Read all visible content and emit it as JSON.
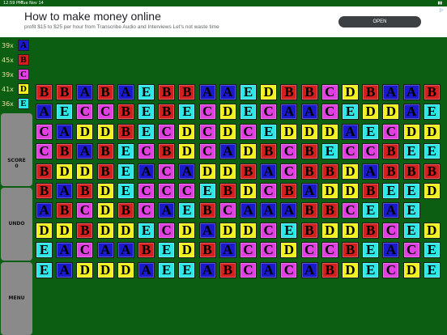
{
  "status": {
    "time": "12:59 PM",
    "date": "Tue Nov 14",
    "battery": "▮▮"
  },
  "ad": {
    "title": "How to make money online",
    "subtitle": "profit $15 to $25 per hour from Transcribe Audio and Interviews Let's not waste time",
    "open_label": "OPEN",
    "adchoices": "▷"
  },
  "counters": [
    {
      "count": "39x",
      "letter": "A",
      "color": "#1a1acc"
    },
    {
      "count": "45x",
      "letter": "B",
      "color": "#d41f1f"
    },
    {
      "count": "39x",
      "letter": "C",
      "color": "#e040e0"
    },
    {
      "count": "41x",
      "letter": "D",
      "color": "#f2f21e"
    },
    {
      "count": "36x",
      "letter": "E",
      "color": "#2ee8e8"
    }
  ],
  "buttons": {
    "score_label": "SCORE",
    "score_value": "0",
    "undo_label": "UNDO",
    "menu_label": "MENU"
  },
  "colors": {
    "A": "#1a1acc",
    "B": "#d41f1f",
    "C": "#e040e0",
    "D": "#f2f21e",
    "E": "#2ee8e8"
  },
  "board": [
    "BBABAEBBAAEDBBCDBAAB",
    "AECCBEBECDECAACEDDAE",
    "CADDBECDCDCEDDDAECDD",
    "CBABECBDCADBCBECCBEE",
    "BDDBEACADDBACBBDABBB",
    "BABDECCCEBDCBADDBEED",
    "ABCDBCAEBCAAABBCEAE",
    "DDBDDECDADDCEBDDBCEDA",
    "EACAABEDBACCDCCBEACE",
    "EADDDAEEABCACABDECDE"
  ]
}
